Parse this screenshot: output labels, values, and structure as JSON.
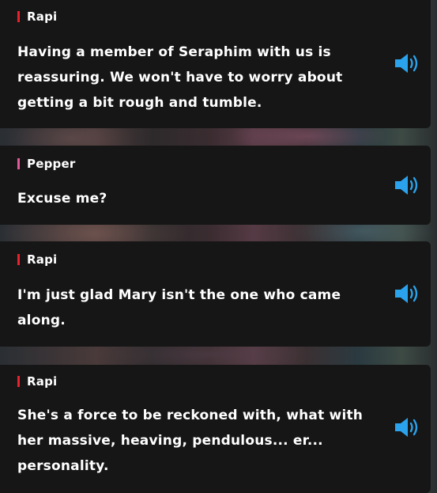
{
  "colors": {
    "card_bg": "#161616",
    "text": "#ffffff",
    "speaker_accent_rapi": "#e8222b",
    "speaker_accent_pepper": "#e25a9a",
    "voice_icon": "#2aa3ec"
  },
  "dialogue": [
    {
      "speaker": "Rapi",
      "text": "Having a member of Seraphim with us is reassuring. We won't have to worry about getting a bit rough and tumble.",
      "icon": "speaker-volume-icon"
    },
    {
      "speaker": "Pepper",
      "text": "Excuse me?",
      "icon": "speaker-volume-icon"
    },
    {
      "speaker": "Rapi",
      "text": "I'm just glad Mary isn't the one who came along.",
      "icon": "speaker-volume-icon"
    },
    {
      "speaker": "Rapi",
      "text": "She's a force to be reckoned with, what with her massive, heaving, pendulous... er... personality.",
      "icon": "speaker-volume-icon"
    }
  ]
}
